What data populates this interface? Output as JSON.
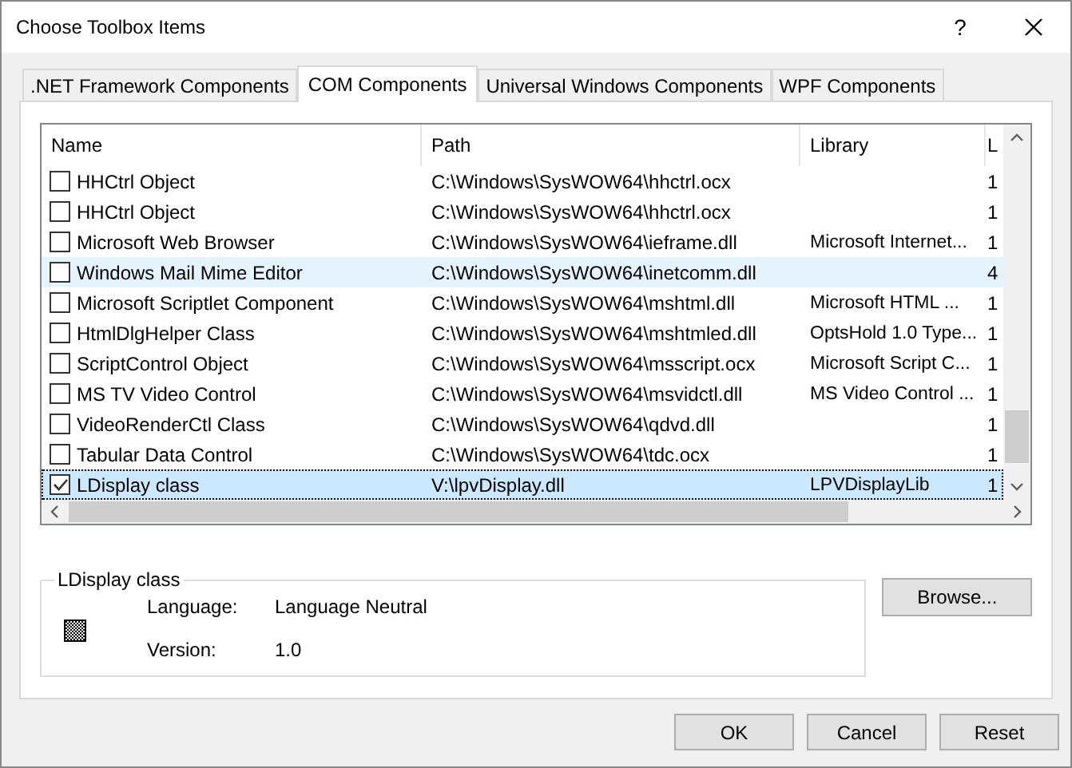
{
  "window": {
    "title": "Choose Toolbox Items",
    "help": "?"
  },
  "tabs": [
    {
      "label": ".NET Framework Components",
      "selected": false
    },
    {
      "label": "COM Components",
      "selected": true
    },
    {
      "label": "Universal Windows Components",
      "selected": false
    },
    {
      "label": "WPF Components",
      "selected": false
    }
  ],
  "table": {
    "columns": [
      "Name",
      "Path",
      "Library",
      "L"
    ],
    "rows": [
      {
        "name": "HHCtrl Object",
        "path": "C:\\Windows\\SysWOW64\\hhctrl.ocx",
        "library": "",
        "column_4": "1",
        "checked": false,
        "selected": false,
        "hovered": false
      },
      {
        "name": "HHCtrl Object",
        "path": "C:\\Windows\\SysWOW64\\hhctrl.ocx",
        "library": "",
        "column_4": "1",
        "checked": false,
        "selected": false,
        "hovered": false
      },
      {
        "name": "Microsoft Web Browser",
        "path": "C:\\Windows\\SysWOW64\\ieframe.dll",
        "library": "Microsoft Internet...",
        "column_4": "1",
        "checked": false,
        "selected": false,
        "hovered": false
      },
      {
        "name": "Windows Mail Mime Editor",
        "path": "C:\\Windows\\SysWOW64\\inetcomm.dll",
        "library": "",
        "column_4": "4",
        "checked": false,
        "selected": false,
        "hovered": true
      },
      {
        "name": "Microsoft Scriptlet Component",
        "path": "C:\\Windows\\SysWOW64\\mshtml.dll",
        "library": "Microsoft HTML ...",
        "column_4": "1",
        "checked": false,
        "selected": false,
        "hovered": false
      },
      {
        "name": "HtmlDlgHelper Class",
        "path": "C:\\Windows\\SysWOW64\\mshtmled.dll",
        "library": "OptsHold 1.0 Type...",
        "column_4": "1",
        "checked": false,
        "selected": false,
        "hovered": false
      },
      {
        "name": "ScriptControl Object",
        "path": "C:\\Windows\\SysWOW64\\msscript.ocx",
        "library": "Microsoft Script C...",
        "column_4": "1",
        "checked": false,
        "selected": false,
        "hovered": false
      },
      {
        "name": "MS TV Video Control",
        "path": "C:\\Windows\\SysWOW64\\msvidctl.dll",
        "library": "MS Video Control ...",
        "column_4": "1",
        "checked": false,
        "selected": false,
        "hovered": false
      },
      {
        "name": "VideoRenderCtl Class",
        "path": "C:\\Windows\\SysWOW64\\qdvd.dll",
        "library": "",
        "column_4": "1",
        "checked": false,
        "selected": false,
        "hovered": false
      },
      {
        "name": "Tabular Data Control",
        "path": "C:\\Windows\\SysWOW64\\tdc.ocx",
        "library": "",
        "column_4": "1",
        "checked": false,
        "selected": false,
        "hovered": false
      },
      {
        "name": "LDisplay class",
        "path": "V:\\lpvDisplay.dll",
        "library": "LPVDisplayLib",
        "column_4": "1",
        "checked": true,
        "selected": true,
        "hovered": false
      }
    ]
  },
  "details": {
    "title": "LDisplay class",
    "fields": [
      {
        "label": "Language:",
        "value": "Language Neutral"
      },
      {
        "label": "Version:",
        "value": "1.0"
      }
    ]
  },
  "browse_button": "Browse...",
  "buttons": [
    "OK",
    "Cancel",
    "Reset"
  ]
}
